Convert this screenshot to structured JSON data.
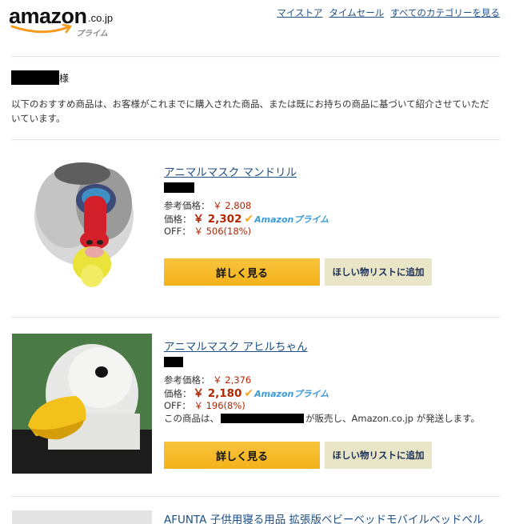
{
  "header": {
    "logo": {
      "word": "amazon",
      "tld": ".co.jp",
      "sub": "プライム"
    },
    "nav": [
      "マイストア",
      "タイムセール",
      "すべてのカテゴリーを見る"
    ]
  },
  "greeting": {
    "suffix": "様"
  },
  "intro": "以下のおすすめ商品は、お客様がこれまでに購入された商品、または既にお持ちの商品に基づいて紹介させていただいています。",
  "products": [
    {
      "title": "アニマルマスク マンドリル",
      "ref_label": "参考価格：",
      "ref_price": "￥ 2,808",
      "price_label": "価格：",
      "price": "￥ 2,302",
      "prime_text": "Amazonプライム",
      "off_label": "OFF：",
      "off": "￥ 506(18%)",
      "detail_button": "詳しく見る",
      "wishlist_button": "ほしい物リストに追加"
    },
    {
      "title": "アニマルマスク アヒルちゃん",
      "ref_label": "参考価格：",
      "ref_price": "￥ 2,376",
      "price_label": "価格：",
      "price": "￥ 2,180",
      "prime_text": "Amazonプライム",
      "off_label": "OFF：",
      "off": "￥ 196(8%)",
      "seller_prefix": "この商品は、",
      "seller_suffix": "が販売し、Amazon.co.jp が発送します。",
      "detail_button": "詳しく見る",
      "wishlist_button": "ほしい物リストに追加"
    },
    {
      "title": "AFUNTA 子供用寝る用品 拡張版ベビーベッドモバイルベッドベル"
    }
  ],
  "colors": {
    "link": "#1e4f85",
    "price": "#b12704",
    "button": "#f7bd2c",
    "wish_button": "#e9e6c8"
  }
}
